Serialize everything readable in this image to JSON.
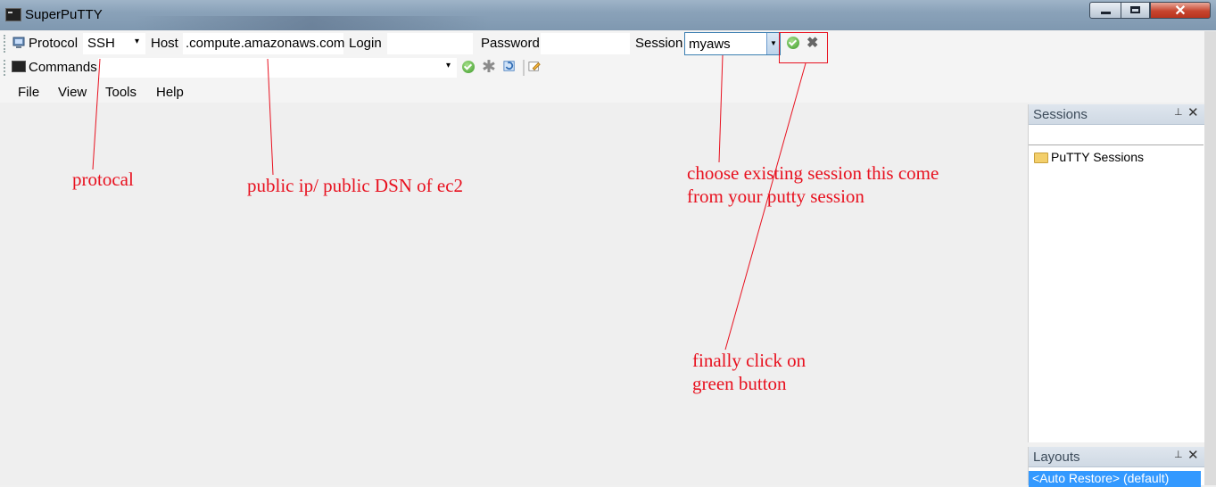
{
  "window": {
    "title": "SuperPuTTY",
    "minimize_icon": "minimize-icon",
    "maximize_icon": "maximize-icon",
    "close_icon": "close-icon",
    "close_glyph": "✕"
  },
  "toolbar": {
    "protocol_label": "Protocol",
    "protocol_value": "SSH",
    "host_label": "Host",
    "host_value": ".compute.amazonaws.com",
    "login_label": "Login",
    "login_value": "",
    "password_label": "Password",
    "password_value": "",
    "session_label": "Session",
    "session_value": "myaws",
    "dropdown_glyph": "▾",
    "connect_icon": "check-circle-icon",
    "clear_icon": "close-x-icon",
    "clear_glyph": "✖"
  },
  "commands_bar": {
    "label": "Commands",
    "value": "",
    "dropdown_glyph": "▾",
    "icons": [
      "check-circle-icon",
      "asterisk-icon",
      "refresh-icon",
      "edit-icon"
    ]
  },
  "menu": {
    "items": [
      {
        "label": "File"
      },
      {
        "label": "View"
      },
      {
        "label": "Tools"
      },
      {
        "label": "Help"
      }
    ]
  },
  "sessions_panel": {
    "title": "Sessions",
    "pin_glyph": "📌",
    "close_glyph": "✕",
    "tree": [
      {
        "label": "PuTTY Sessions",
        "icon": "folder-icon"
      }
    ]
  },
  "layouts_panel": {
    "title": "Layouts",
    "pin_glyph": "📌",
    "close_glyph": "✕",
    "selected_item": "<Auto Restore> (default)"
  },
  "annotations": {
    "protocol": "protocal",
    "host": "public ip/ public DSN of ec2",
    "session_line1": "choose existing session this come",
    "session_line2": "from your putty session",
    "click_line1": "finally click on",
    "click_line2": "green button",
    "color": "#e8111f"
  },
  "colors": {
    "titlebar": "#8aa2b9",
    "selection": "#3399ff",
    "close_button": "#c7452f"
  }
}
